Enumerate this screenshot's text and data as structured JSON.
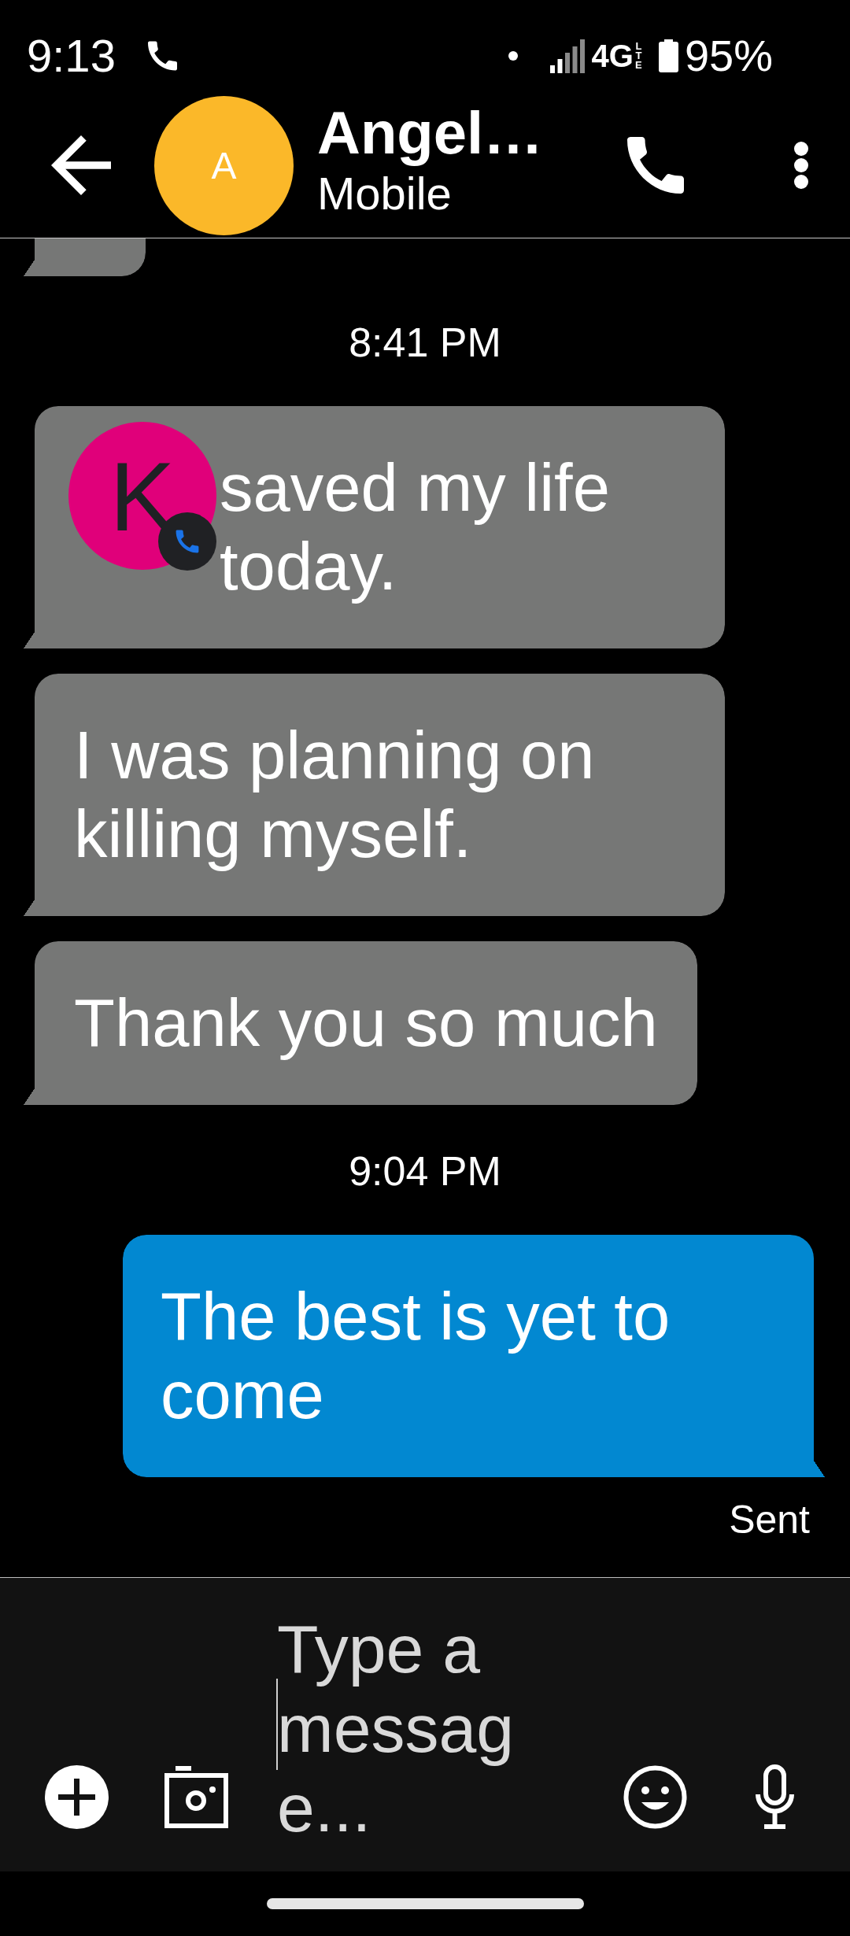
{
  "status_bar": {
    "time": "9:13",
    "network": "4G",
    "network_detail": "LTE",
    "battery": "95%"
  },
  "header": {
    "avatar_initial": "A",
    "name": "Angel…",
    "subtitle": "Mobile"
  },
  "messages": [
    {
      "kind": "partial"
    },
    {
      "kind": "timestamp",
      "text": "8:41 PM"
    },
    {
      "kind": "received",
      "text": "saved my life today.",
      "covered_by_chat_head": true
    },
    {
      "kind": "received",
      "text": "I was planning on killing myself.",
      "covered_by_chat_head": false
    },
    {
      "kind": "received",
      "text": "Thank you so much",
      "covered_by_chat_head": false
    },
    {
      "kind": "timestamp",
      "text": "9:04 PM"
    },
    {
      "kind": "sent",
      "text": "The best is yet to come",
      "status": "Sent"
    }
  ],
  "chat_head": {
    "initial": "K"
  },
  "composer": {
    "placeholder": "Type a message..."
  }
}
